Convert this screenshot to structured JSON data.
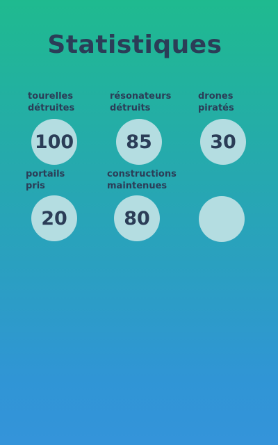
{
  "screen": {
    "title": "Statistiques"
  },
  "stats": [
    {
      "label_line1": "tourelles",
      "label_line2": "détruites",
      "value": "100"
    },
    {
      "label_line1": "résonateurs",
      "label_line2": "détruits",
      "value": "85"
    },
    {
      "label_line1": "drones",
      "label_line2": "piratés",
      "value": "30"
    },
    {
      "label_line1": "portails",
      "label_line2": "pris",
      "value": "20"
    },
    {
      "label_line1": "constructions",
      "label_line2": "maintenues",
      "value": "80"
    },
    {
      "label_line1": "",
      "label_line2": "",
      "value": ""
    }
  ],
  "colors": {
    "gradient_top": "#1fba8f",
    "gradient_bottom": "#3494da",
    "circle_fill": "#b4dde1",
    "text": "#2b3d57"
  }
}
